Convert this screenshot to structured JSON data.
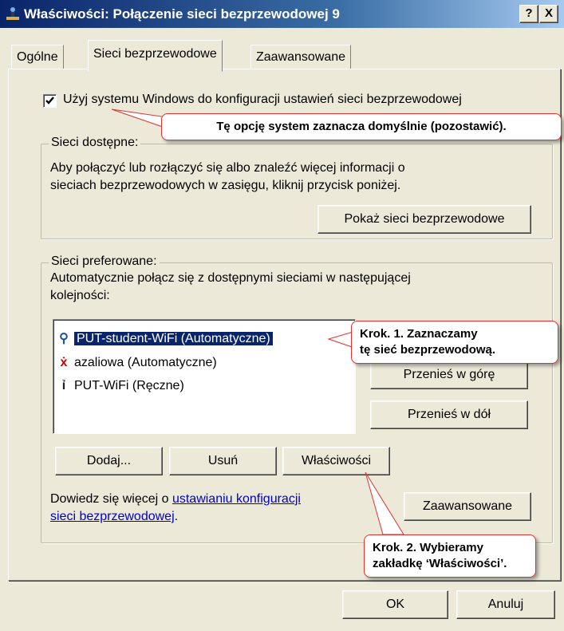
{
  "window": {
    "title": "Właściwości: Połączenie sieci bezprzewodowej 9",
    "help_btn": "?",
    "close_btn": "X"
  },
  "tabs": [
    {
      "label": "Ogólne"
    },
    {
      "label": "Sieci bezprzewodowe"
    },
    {
      "label": "Zaawansowane"
    }
  ],
  "checkbox": {
    "label": "Użyj systemu Windows do konfiguracji ustawień sieci bezprzewodowej",
    "checked": true
  },
  "available": {
    "legend": "Sieci dostępne:",
    "desc_line1": "Aby połączyć lub rozłączyć się albo znaleźć więcej informacji o",
    "desc_line2": "sieciach bezprzewodowych w zasięgu, kliknij przycisk poniżej.",
    "show_button": "Pokaż sieci bezprzewodowe"
  },
  "preferred": {
    "legend": "Sieci preferowane:",
    "desc_line1": "Automatycznie połącz się z dostępnymi sieciami w następującej",
    "desc_line2": "kolejności:",
    "networks": [
      {
        "name": "PUT-student-WiFi (Automatyczne)",
        "icon": "antenna-icon",
        "selected": true
      },
      {
        "name": "azaliowa (Automatyczne)",
        "icon": "antenna-disconnected-icon",
        "selected": false
      },
      {
        "name": "PUT-WiFi (Ręczne)",
        "icon": "antenna-icon",
        "selected": false
      }
    ],
    "move_up": "Przenieś w górę",
    "move_down": "Przenieś w dół",
    "add": "Dodaj...",
    "remove": "Usuń",
    "properties": "Właściwości",
    "learn_prefix": "Dowiedz się więcej o ",
    "learn_link1": "ustawianiu konfiguracji",
    "learn_link2": "sieci bezprzewodowej",
    "learn_suffix": ".",
    "advanced": "Zaawansowane"
  },
  "footer": {
    "ok": "OK",
    "cancel": "Anuluj"
  },
  "callouts": {
    "c1": "Tę opcję system zaznacza domyślnie (pozostawić).",
    "c2_line1": "Krok. 1. Zaznaczamy",
    "c2_line2": "tę sieć bezprzewodową.",
    "c3_line1": "Krok. 2. Wybieramy",
    "c3_line2": "zakładkę ‘Właściwości’."
  },
  "colors": {
    "titlebar": "#0A246A",
    "dialog": "#ECE9D8",
    "selection": "#0A246A",
    "link": "#0000CC",
    "callout_border": "#DD3333"
  }
}
